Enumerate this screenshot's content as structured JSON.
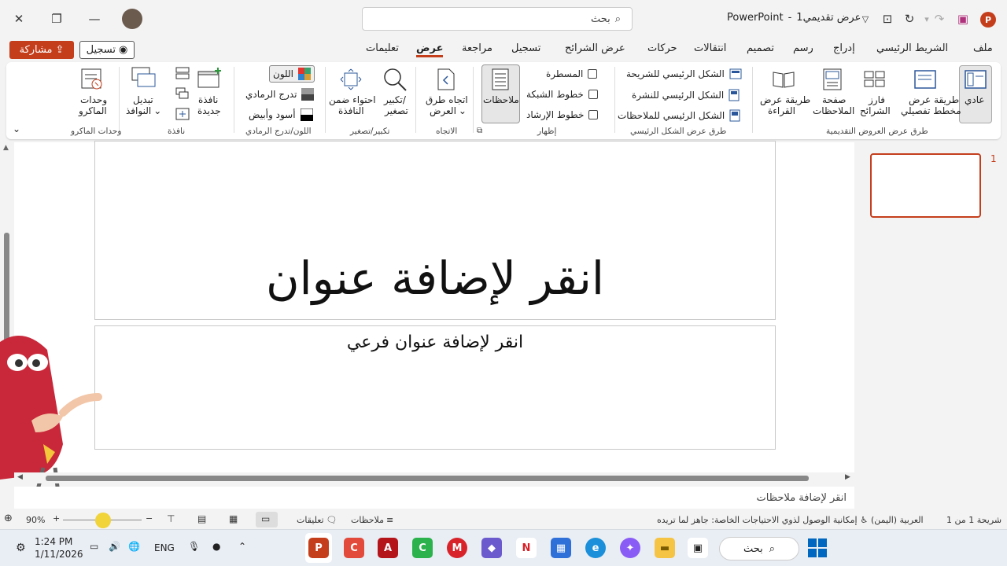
{
  "titlebar": {
    "app_name": "PowerPoint",
    "separator": "-",
    "doc_name": "عرض تقديمي1",
    "search_placeholder": "بحث"
  },
  "tabs": [
    "ملف",
    "الشريط الرئيسي",
    "إدراج",
    "رسم",
    "تصميم",
    "انتقالات",
    "حركات",
    "عرض الشرائح",
    "تسجيل",
    "مراجعة",
    "عرض",
    "تعليمات"
  ],
  "active_tab": "عرض",
  "share_label": "مشاركة",
  "record_label": "تسجيل",
  "ribbon": {
    "presentation_views": {
      "group_label": "طرق عرض العروض التقديمية",
      "normal": "عادي",
      "outline_1": "طريقة عرض",
      "outline_2": "مخطط تفصيلي",
      "sorter_1": "فارز",
      "sorter_2": "الشرائح",
      "notes_page_1": "صفحة",
      "notes_page_2": "الملاحظات",
      "reading_1": "طريقة عرض",
      "reading_2": "القراءة"
    },
    "master_views": {
      "group_label": "طرق عرض الشكل الرئيسي",
      "slide_master": "الشكل الرئيسي للشريحة",
      "handout_master": "الشكل الرئيسي للنشرة",
      "notes_master": "الشكل الرئيسي للملاحظات"
    },
    "show": {
      "group_label": "إظهار",
      "ruler": "المسطرة",
      "gridlines": "خطوط الشبكة",
      "guides": "خطوط الإرشاد",
      "notes": "ملاحظات"
    },
    "direction": {
      "group_label": "الاتجاه",
      "label_1": "اتجاه طرق",
      "label_2": "العرض"
    },
    "zoom": {
      "group_label": "تكبير/تصغير",
      "zoom_1": "تكبير/",
      "zoom_2": "تصغير",
      "fit_1": "احتواء ضمن",
      "fit_2": "النافذة"
    },
    "color": {
      "group_label": "اللون/تدرج الرمادي",
      "color": "اللون",
      "grayscale": "تدرج الرمادي",
      "bw": "أسود وأبيض"
    },
    "window": {
      "group_label": "نافذة",
      "new_1": "نافذة",
      "new_2": "جديدة",
      "switch_1": "تبديل",
      "switch_2": "النوافذ"
    },
    "macros": {
      "group_label": "وحدات الماكرو",
      "label_1": "وحدات",
      "label_2": "الماكرو"
    }
  },
  "slide": {
    "title_placeholder": "انقر لإضافة عنوان",
    "subtitle_placeholder": "انقر لإضافة عنوان فرعي"
  },
  "notes_placeholder": "انقر لإضافة ملاحظات",
  "thumbnail_number": "1",
  "status": {
    "slide_info": "شريحة 1 من 1",
    "language": "العربية (اليمن)",
    "accessibility": "إمكانية الوصول لذوي الاحتياجات الخاصة: جاهز لما تريده",
    "notes": "ملاحظات",
    "comments": "تعليقات",
    "zoom": "90%"
  },
  "taskbar": {
    "search": "بحث",
    "lang": "ENG",
    "time": "1:24 PM",
    "date": "1/11/2026",
    "colors": {
      "ppt": "#c43e1c",
      "accent": "#0067c0"
    }
  }
}
